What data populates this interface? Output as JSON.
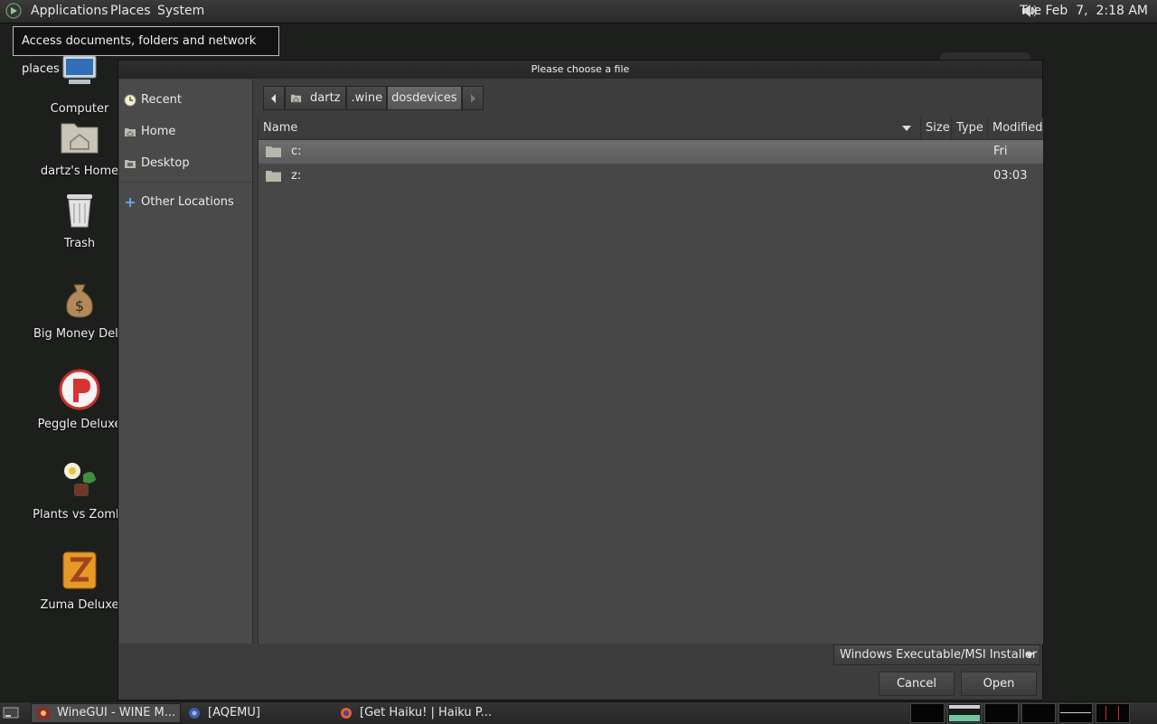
{
  "top_panel": {
    "menus": [
      "Applications",
      "Places",
      "System"
    ],
    "clock": "Tue Feb  7,  2:18 AM"
  },
  "tooltip": "Access documents, folders and network places",
  "desktop_icons": [
    {
      "label": "Computer"
    },
    {
      "label": "dartz's Home"
    },
    {
      "label": "Trash"
    },
    {
      "label": "Big Money Delu"
    },
    {
      "label": "Peggle Deluxe"
    },
    {
      "label": "Plants vs Zombi"
    },
    {
      "label": "Zuma Deluxe"
    }
  ],
  "dialog": {
    "title": "Please choose a file",
    "sidebar": [
      {
        "label": "Recent"
      },
      {
        "label": "Home"
      },
      {
        "label": "Desktop"
      },
      {
        "label": "Other Locations"
      }
    ],
    "path": [
      "dartz",
      ".wine",
      "dosdevices"
    ],
    "columns": [
      "Name",
      "Size",
      "Type",
      "Modified"
    ],
    "files": [
      {
        "name": "c:",
        "modified": "Fri",
        "selected": true
      },
      {
        "name": "z:",
        "modified": "03:03",
        "selected": false
      }
    ],
    "filter": "Windows Executable/MSI Installer",
    "cancel_label": "Cancel",
    "open_label": "Open"
  },
  "taskbar": {
    "tasks": [
      {
        "label": "WineGUI - WINE M..."
      },
      {
        "label": "[AQEMU]"
      },
      {
        "label": "[Get Haiku! | Haiku P..."
      }
    ]
  }
}
